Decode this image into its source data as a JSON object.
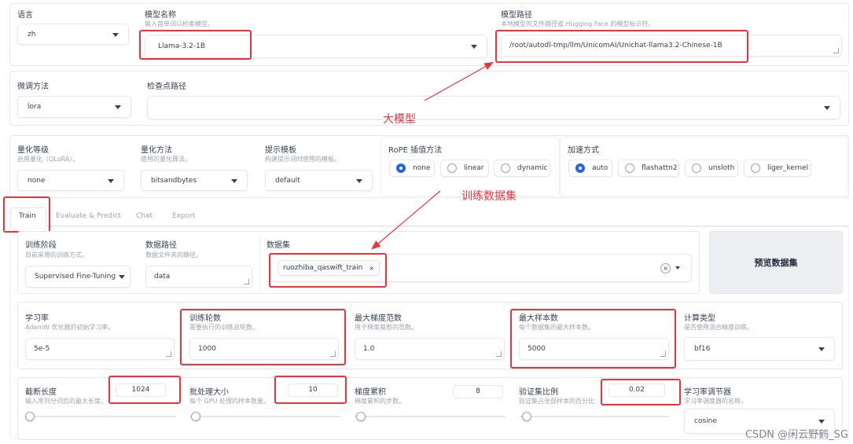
{
  "model": {
    "lang_label": "语言",
    "lang_value": "zh",
    "name_label": "模型名称",
    "name_desc": "输入首单词以检索模型。",
    "name_value": "Llama-3.2-1B",
    "path_label": "模型路径",
    "path_desc": "本地模型的文件路径或 Hugging Face 的模型标识符。",
    "path_value": "/root/autodl-tmp/llm/UnicomAI/Unichat-llama3.2-Chinese-1B"
  },
  "finetune": {
    "method_label": "微调方法",
    "method_value": "lora",
    "ckpt_label": "检查点路径",
    "ckpt_value": ""
  },
  "quant": {
    "bit_label": "量化等级",
    "bit_desc": "启用量化（QLoRA）。",
    "bit_value": "none",
    "method_label": "量化方法",
    "method_desc": "使用的量化算法。",
    "method_value": "bitsandbytes",
    "template_label": "提示模板",
    "template_desc": "构建提示词时使用的模板。",
    "template_value": "default",
    "rope_label": "RoPE 插值方法",
    "rope_options": [
      "none",
      "linear",
      "dynamic"
    ],
    "rope_selected": "none",
    "accel_label": "加速方式",
    "accel_options": [
      "auto",
      "flashattn2",
      "unsloth",
      "liger_kernel"
    ],
    "accel_selected": "auto"
  },
  "tabs": [
    "Train",
    "Evaluate & Predict",
    "Chat",
    "Export"
  ],
  "active_tab": "Train",
  "train": {
    "stage_label": "训练阶段",
    "stage_desc": "目前采用的训练方式。",
    "stage_value": "Supervised Fine-Tuning",
    "dir_label": "数据路径",
    "dir_desc": "数据文件夹的路径。",
    "dir_value": "data",
    "dataset_label": "数据集",
    "dataset_chip": "ruozhiba_qaswift_train",
    "preview_button": "预览数据集"
  },
  "params": {
    "lr_label": "学习率",
    "lr_desc": "AdamW 优化器的初始学习率。",
    "lr_value": "5e-5",
    "epochs_label": "训练轮数",
    "epochs_desc": "需要执行的训练总轮数。",
    "epochs_value": "1000",
    "grad_label": "最大梯度范数",
    "grad_desc": "用于梯度裁剪的范数。",
    "grad_value": "1.0",
    "samples_label": "最大样本数",
    "samples_desc": "每个数据集的最大样本数。",
    "samples_value": "5000",
    "compute_label": "计算类型",
    "compute_desc": "是否使用混合精度训练。",
    "compute_value": "bf16"
  },
  "sliders": {
    "cutoff_label": "截断长度",
    "cutoff_desc": "输入序列分词后的最大长度。",
    "cutoff_value": "1024",
    "batch_label": "批处理大小",
    "batch_desc": "每个 GPU 处理的样本数量。",
    "batch_value": "10",
    "accum_label": "梯度累积",
    "accum_desc": "梯度累积的步数。",
    "accum_value": "8",
    "val_label": "验证集比例",
    "val_desc": "验证集占全部样本的百分比",
    "val_value": "0.02",
    "sched_label": "学习率调节器",
    "sched_desc": "学习率调度器的名称。",
    "sched_value": "cosine"
  },
  "annotations": {
    "model": "大模型",
    "dataset": "训练数据集"
  },
  "watermark": "CSDN @闲云野鹤_SG",
  "colors": {
    "highlight": "#e8343f",
    "radio_selected": "#2563eb"
  }
}
